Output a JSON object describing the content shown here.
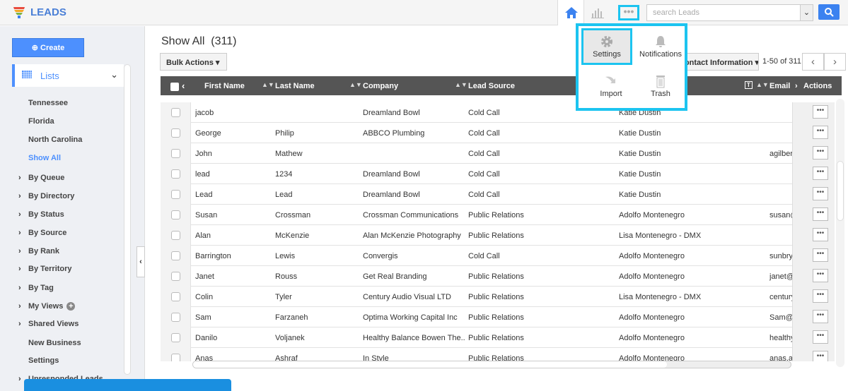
{
  "app": {
    "title": "LEADS",
    "search_placeholder": "search Leads"
  },
  "sidebar": {
    "create_label": "Create",
    "lists_label": "Lists",
    "items": [
      {
        "label": "Tennessee",
        "arrow": false
      },
      {
        "label": "Florida",
        "arrow": false
      },
      {
        "label": "North Carolina",
        "arrow": false
      },
      {
        "label": "Show All",
        "arrow": false,
        "active": true
      },
      {
        "label": "By Queue",
        "arrow": true
      },
      {
        "label": "By Directory",
        "arrow": true
      },
      {
        "label": "By Status",
        "arrow": true
      },
      {
        "label": "By Source",
        "arrow": true
      },
      {
        "label": "By Rank",
        "arrow": true
      },
      {
        "label": "By Territory",
        "arrow": true
      },
      {
        "label": "By Tag",
        "arrow": true
      },
      {
        "label": "My Views",
        "arrow": true,
        "plus": true
      },
      {
        "label": "Shared Views",
        "arrow": true
      },
      {
        "label": "New Business",
        "arrow": false
      },
      {
        "label": "Settings",
        "arrow": false
      },
      {
        "label": "Unresponded Leads",
        "arrow": true
      }
    ]
  },
  "main": {
    "title": "Show All",
    "count": "(311)",
    "bulk_actions": "Bulk Actions",
    "view_select": "Contact Information",
    "pagination": "1-50 of 311"
  },
  "table": {
    "headers": [
      "First Name",
      "Last Name",
      "Company",
      "Lead Source",
      "Email",
      "Actions"
    ],
    "rows": [
      [
        "jacob",
        "",
        "Dreamland Bowl",
        "Cold Call",
        "Katie Dustin",
        ""
      ],
      [
        "George",
        "Philip",
        "ABBCO Plumbing",
        "Cold Call",
        "Katie Dustin",
        ""
      ],
      [
        "John",
        "Mathew",
        "",
        "Cold Call",
        "Katie Dustin",
        "agilber"
      ],
      [
        "lead",
        "1234",
        "Dreamland Bowl",
        "Cold Call",
        "Katie Dustin",
        ""
      ],
      [
        "Lead",
        "Lead",
        "Dreamland Bowl",
        "Cold Call",
        "Katie Dustin",
        ""
      ],
      [
        "Susan",
        "Crossman",
        "Crossman Communications",
        "Public Relations",
        "Adolfo Montenegro",
        "susan@"
      ],
      [
        "Alan",
        "McKenzie",
        "Alan McKenzie Photography",
        "Public Relations",
        "Lisa Montenegro - DMX",
        ""
      ],
      [
        "Barrington",
        "Lewis",
        "Convergis",
        "Cold Call",
        "Adolfo Montenegro",
        "sunbry"
      ],
      [
        "Janet",
        "Rouss",
        "Get Real Branding",
        "Public Relations",
        "Adolfo Montenegro",
        "janet@"
      ],
      [
        "Colin",
        "Tyler",
        "Century Audio Visual LTD",
        "Public Relations",
        "Lisa Montenegro - DMX",
        "century"
      ],
      [
        "Sam",
        "Farzaneh",
        "Optima Working Capital Inc",
        "Public Relations",
        "Adolfo Montenegro",
        "Sam@"
      ],
      [
        "Danilo",
        "Voljanek",
        "Healthy Balance Bowen The...",
        "Public Relations",
        "Adolfo Montenegro",
        "healthy"
      ],
      [
        "Anas",
        "Ashraf",
        "In Style",
        "Public Relations",
        "Adolfo Montenegro",
        "anas.a"
      ]
    ]
  },
  "popup": {
    "items": [
      {
        "label": "Settings",
        "icon": "gear-icon"
      },
      {
        "label": "Notifications",
        "icon": "bell-icon"
      },
      {
        "label": "Import",
        "icon": "import-arrow-icon"
      },
      {
        "label": "Trash",
        "icon": "trash-icon"
      }
    ]
  },
  "colors": {
    "accent": "#4d90fe",
    "highlight": "#1cc4f0",
    "table_header": "#555555"
  }
}
